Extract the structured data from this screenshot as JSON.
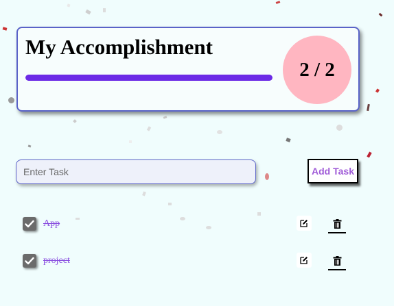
{
  "stats": {
    "title": "My Accomplishment",
    "progress_fraction": 1.0,
    "count_text": "2 / 2",
    "accent_color": "#6c2be6",
    "circle_color": "#ffb6c1"
  },
  "input": {
    "placeholder": "Enter Task",
    "value": ""
  },
  "add_button": {
    "label": "Add Task"
  },
  "tasks": [
    {
      "label": "App",
      "completed": true,
      "edit_icon": "edit-icon",
      "delete_icon": "trash-icon"
    },
    {
      "label": "project",
      "completed": true,
      "edit_icon": "edit-icon",
      "delete_icon": "trash-icon"
    }
  ],
  "decoration": "confetti"
}
